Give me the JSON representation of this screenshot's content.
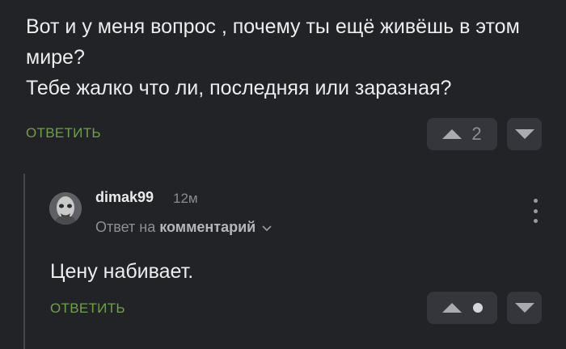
{
  "parent_comment": {
    "lines": [
      "Вот и у меня вопрос , почему ты ещё живёшь в этом мире?",
      "Тебе жалко что ли, последняя или заразная?"
    ],
    "reply_label": "ОТВЕТИТЬ",
    "vote_count": "2"
  },
  "child_comment": {
    "username": "dimak99",
    "time": "12м",
    "reply_to_prefix": "Ответ на",
    "reply_to_target": "комментарий",
    "text": "Цену набивает.",
    "reply_label": "ОТВЕТИТЬ"
  },
  "icons": {
    "upvote": "triangle-up-icon",
    "downvote": "triangle-down-icon",
    "menu": "kebab-menu-icon",
    "chevron": "chevron-down-icon"
  },
  "colors": {
    "background": "#222327",
    "accent_green": "#6fa04a",
    "button_bg": "#34363b"
  }
}
